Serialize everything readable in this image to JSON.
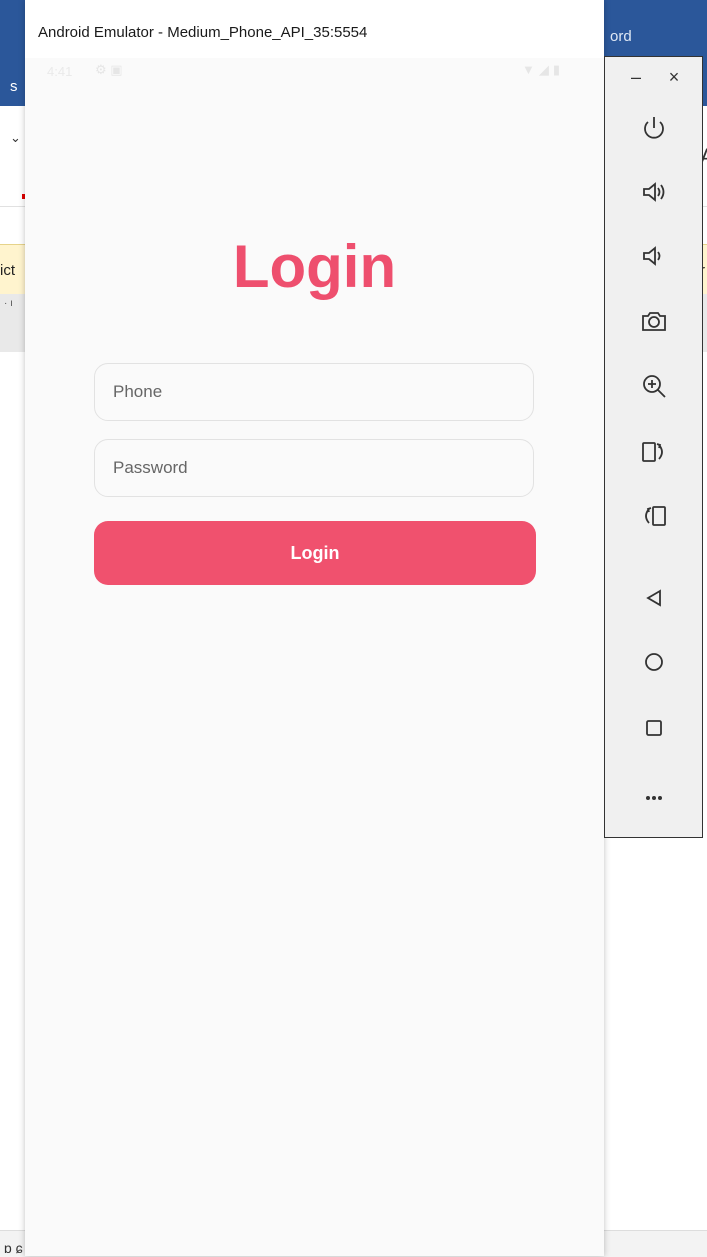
{
  "background": {
    "left_fragment": "s",
    "word_fragment": "ord",
    "chevron": "⌄",
    "banner_left": "ict",
    "banner_right": "r",
    "ruler_marks": "· ı",
    "right_fragment": "A",
    "bottom_fragment": "ɒ ɕ"
  },
  "emulator": {
    "title": "Android Emulator - Medium_Phone_API_35:5554",
    "status": {
      "time": "4:41",
      "left_icons": "⚙ ▣",
      "right_icons": "▼◢▮"
    },
    "screen": {
      "heading": "Login",
      "phone_placeholder": "Phone",
      "password_placeholder": "Password",
      "login_button": "Login"
    },
    "toolbar": {
      "minimize": "–",
      "close": "×",
      "buttons": [
        "power-icon",
        "volume-up-icon",
        "volume-down-icon",
        "camera-icon",
        "zoom-icon",
        "rotate-right-icon",
        "rotate-left-icon",
        "back-icon",
        "home-icon",
        "overview-icon",
        "more-icon"
      ]
    }
  }
}
